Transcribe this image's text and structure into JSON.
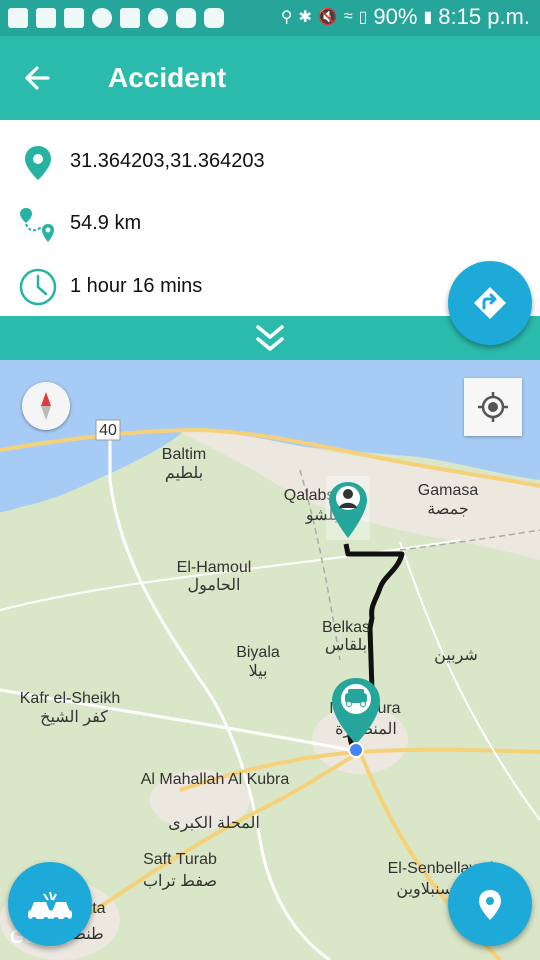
{
  "status_bar": {
    "battery": "90%",
    "time": "8:15 p.m."
  },
  "app_bar": {
    "title": "Accident"
  },
  "info": {
    "coordinates": "31.364203,31.364203",
    "distance": "54.9 km",
    "duration": "1 hour 16 mins"
  },
  "map": {
    "road_number": "40",
    "places": [
      {
        "en": "Baltim",
        "ar": "بلطيم"
      },
      {
        "en": "Qalabsho",
        "ar": "بلشو"
      },
      {
        "en": "Gamasa",
        "ar": "جمصة"
      },
      {
        "en": "El-Hamoul",
        "ar": "الحامول"
      },
      {
        "en": "Belkas",
        "ar": "بلقاس"
      },
      {
        "en": "Biyala",
        "ar": "بيلا"
      },
      {
        "en": "Kafr el-Sheikh",
        "ar": "كفر الشيخ"
      },
      {
        "en": "Mansoura",
        "ar": "المنصورة"
      },
      {
        "en": "Al Mahallah Al Kubra",
        "ar": "المحلة الكبرى"
      },
      {
        "en": "Saft Turab",
        "ar": "صفط تراب"
      },
      {
        "en": "El-Senbellawein",
        "ar": "السنبلاوين"
      },
      {
        "en": "Tanta",
        "ar": "طنطا"
      },
      {
        "ar": "شربين"
      }
    ],
    "attribution": "Google",
    "colors": {
      "water": "#a6cbf4",
      "land": "#d9e6c8",
      "urban": "#ece8df",
      "route": "#111111",
      "marker": "#26a69a"
    }
  },
  "icons": {
    "location": "location-pin-icon",
    "route": "route-icon",
    "clock": "clock-icon",
    "directions": "directions-icon",
    "accident": "car-crash-icon",
    "my_location": "my-location-icon"
  },
  "colors": {
    "primary": "#2bbbad",
    "status": "#26a69a",
    "fab": "#1eaad9"
  }
}
